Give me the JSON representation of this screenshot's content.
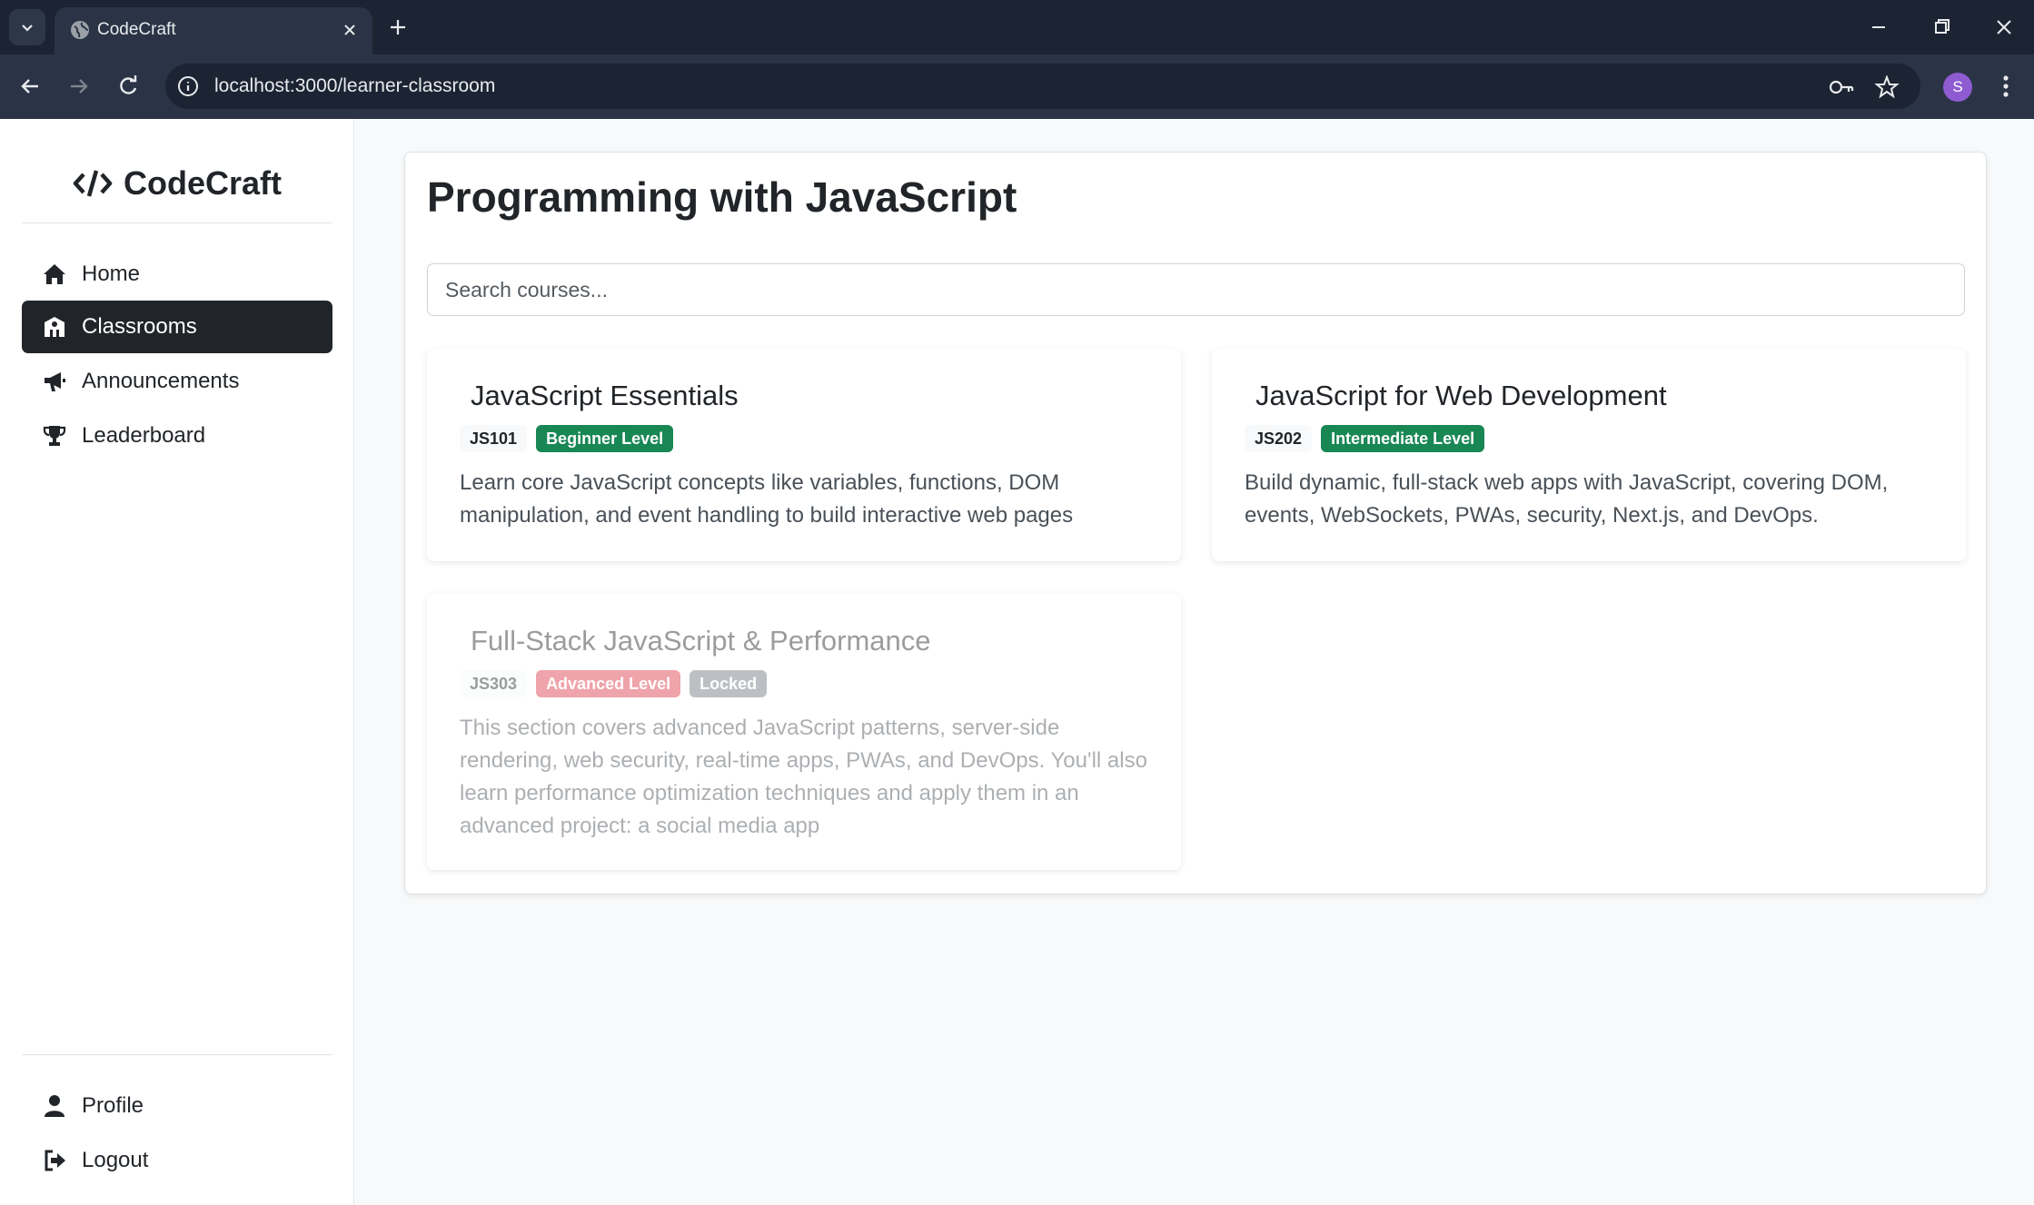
{
  "browser": {
    "tab_title": "CodeCraft",
    "url": "localhost:3000/learner-classroom",
    "profile_initial": "S"
  },
  "sidebar": {
    "brand": "CodeCraft",
    "nav": [
      {
        "label": "Home",
        "icon": "home-icon",
        "active": false
      },
      {
        "label": "Classrooms",
        "icon": "classroom-icon",
        "active": true
      },
      {
        "label": "Announcements",
        "icon": "megaphone-icon",
        "active": false
      },
      {
        "label": "Leaderboard",
        "icon": "trophy-icon",
        "active": false
      }
    ],
    "footer": [
      {
        "label": "Profile",
        "icon": "user-icon"
      },
      {
        "label": "Logout",
        "icon": "logout-icon"
      }
    ]
  },
  "main": {
    "title": "Programming with JavaScript",
    "search_placeholder": "Search courses...",
    "courses": [
      {
        "title": "JavaScript Essentials",
        "code": "JS101",
        "level": "Beginner Level",
        "level_color": "#198754",
        "locked": false,
        "description": "Learn core JavaScript concepts like variables, functions, DOM manipulation, and event handling to build interactive web pages"
      },
      {
        "title": "JavaScript for Web Development",
        "code": "JS202",
        "level": "Intermediate Level",
        "level_color": "#198754",
        "locked": false,
        "description": "Build dynamic, full-stack web apps with JavaScript, covering DOM, events, WebSockets, PWAs, security, Next.js, and DevOps."
      },
      {
        "title": "Full-Stack JavaScript & Performance",
        "code": "JS303",
        "level": "Advanced Level",
        "level_color": "#dc3545",
        "locked": true,
        "locked_label": "Locked",
        "description": "This section covers advanced JavaScript patterns, server-side rendering, web security, real-time apps, PWAs, and DevOps. You'll also learn performance optimization techniques and apply them in an advanced project: a social media app"
      }
    ]
  },
  "colors": {
    "sidebar_active_bg": "#212529",
    "success": "#198754",
    "danger": "#dc3545",
    "secondary": "#6c757d"
  }
}
